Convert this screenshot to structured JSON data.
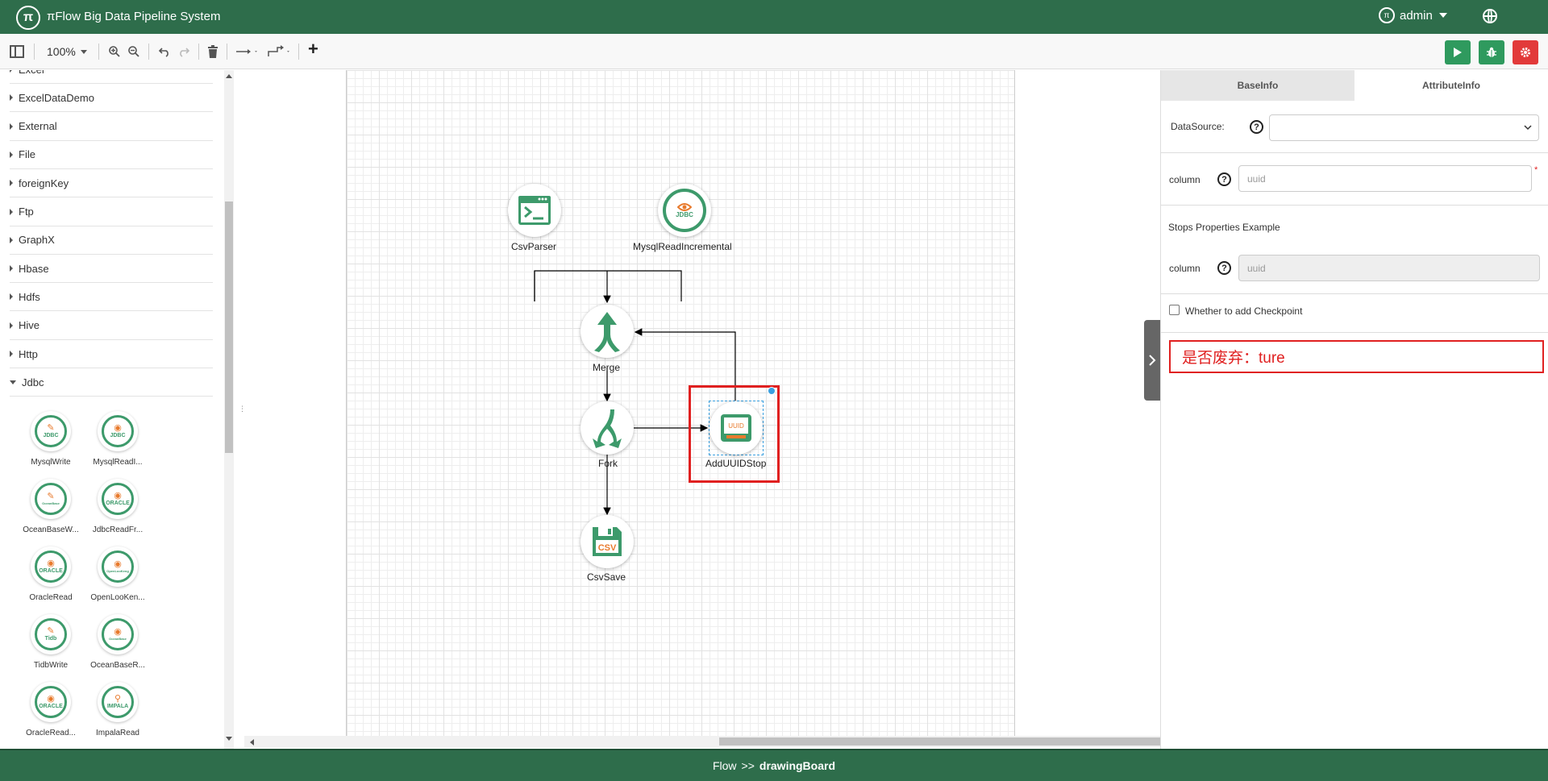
{
  "header": {
    "logo_text": "π",
    "title": "πFlow Big Data Pipeline System",
    "user_icon_text": "π",
    "username": "admin"
  },
  "toolbar": {
    "zoom": "100%",
    "add_symbol": "+"
  },
  "colors": {
    "brand_green": "#2e6d4b",
    "run_button": "#2f9a5e",
    "debug_button": "#2f9a5e",
    "settings_button": "#e23a3a",
    "icon_green": "#3d9a6b",
    "icon_orange": "#e87a2d",
    "highlight_red": "#e02020"
  },
  "sidebar": {
    "categories": [
      "Excel",
      "ExcelDataDemo",
      "External",
      "File",
      "foreignKey",
      "Ftp",
      "GraphX",
      "Hbase",
      "Hdfs",
      "Hive",
      "Http",
      "Jdbc"
    ],
    "expanded_category": "Jdbc",
    "stops": [
      {
        "label": "MysqlWrite",
        "badge": "JDBC",
        "icon": "pencil-icon"
      },
      {
        "label": "MysqlReadI...",
        "badge": "JDBC",
        "icon": "eye-icon"
      },
      {
        "label": "OceanBaseW...",
        "badge": "OceanBase",
        "icon": "pencil-icon"
      },
      {
        "label": "JdbcReadFr...",
        "badge": "ORACLE",
        "icon": "eye-icon"
      },
      {
        "label": "OracleRead",
        "badge": "ORACLE",
        "icon": "eye-icon"
      },
      {
        "label": "OpenLooKen...",
        "badge": "OpenLooKeng",
        "icon": "eye-icon"
      },
      {
        "label": "TidbWrite",
        "badge": "Tidb",
        "icon": "pencil-icon"
      },
      {
        "label": "OceanBaseR...",
        "badge": "OceanBase",
        "icon": "eye-icon"
      },
      {
        "label": "OracleRead...",
        "badge": "ORACLE",
        "icon": "eye-icon"
      },
      {
        "label": "ImpalaRead",
        "badge": "IMPALA",
        "icon": "magnifier-icon"
      }
    ]
  },
  "canvas": {
    "nodes": [
      {
        "label": "CsvParser",
        "icon": "terminal-icon"
      },
      {
        "label": "MysqlReadIncremental",
        "badge": "JDBC",
        "icon": "eye-icon"
      },
      {
        "label": "Merge",
        "icon": "merge-icon"
      },
      {
        "label": "Fork",
        "icon": "fork-icon"
      },
      {
        "label": "AddUUIDStop",
        "badge": "UUID",
        "icon": "uuid-icon"
      },
      {
        "label": "CsvSave",
        "badge": "CSV",
        "icon": "save-icon"
      }
    ],
    "selected_node": "AddUUIDStop"
  },
  "panel": {
    "tabs": [
      "BaseInfo",
      "AttributeInfo"
    ],
    "active_tab": "AttributeInfo",
    "datasource_label": "DataSource:",
    "datasource_value": "",
    "column_label": "column",
    "column_placeholder": "uuid",
    "example_heading": "Stops Properties Example",
    "example_column_label": "column",
    "example_column_placeholder": "uuid",
    "checkpoint_label": "Whether to add Checkpoint",
    "checkpoint_checked": false,
    "deprecated_notice": "是否废弃：ture",
    "help_symbol": "?",
    "required_mark": "*"
  },
  "footer": {
    "prefix": "Flow",
    "separator": ">>",
    "current": "drawingBoard"
  }
}
